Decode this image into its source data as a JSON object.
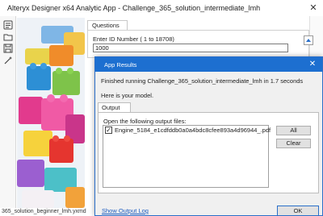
{
  "app": {
    "title": "Alteryx Designer  x64  Analytic App  -  Challenge_365_solution_intermediate_lmh",
    "close_glyph": "✕",
    "status_text": "365_solution_beginner_lmh.yxmd"
  },
  "questions": {
    "tab_label": "Questions",
    "id_label": "Enter ID Number ( 1 to 18708)",
    "id_value": "1000"
  },
  "dialog": {
    "title": "App Results",
    "close_glyph": "✕",
    "finished_message": "Finished running Challenge_365_solution_intermediate_lmh in 1.7 seconds",
    "model_message": "Here is your model.",
    "tab_label": "Output Files",
    "open_label": "Open the following output files:",
    "files": [
      {
        "checked": true,
        "check_glyph": "✓",
        "name": "Engine_5184_e1cdfddb0a0a4bdc8cfee893a4d96944_.pdf"
      }
    ],
    "all_label": "All",
    "clear_label": "Clear",
    "show_log_label": "Show Output Log",
    "ok_label": "OK"
  },
  "colors": {
    "dialog_title_bg": "#1d6fd0",
    "link": "#1b5bbf"
  }
}
